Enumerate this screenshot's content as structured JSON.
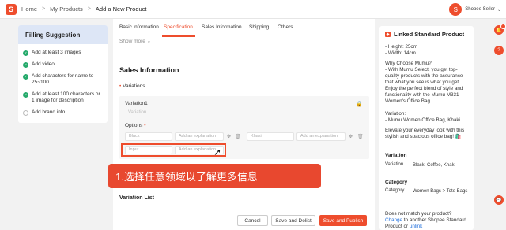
{
  "header": {
    "logo_glyph": "S",
    "breadcrumbs": [
      "Home",
      "My Products",
      "Add a New Product"
    ],
    "separator": ">",
    "user": "Shopee Seller",
    "user_caret": "⌄",
    "avatar_glyph": "S"
  },
  "filling": {
    "title": "Filling Suggestion",
    "tips": [
      {
        "text": "Add at least 3 images",
        "done": true
      },
      {
        "text": "Add video",
        "done": true
      },
      {
        "text": "Add characters for name to 25~100",
        "done": true
      },
      {
        "text": "Add at least 100 characters or 1 image for description",
        "done": true
      },
      {
        "text": "Add brand info",
        "done": false
      }
    ]
  },
  "tabs": [
    "Basic information",
    "Specification",
    "Sales Information",
    "Shipping",
    "Others"
  ],
  "active_tab": "Specification",
  "show_more": "Show more ⌄",
  "sales": {
    "title": "Sales Information",
    "variations_label": "Variations",
    "variation_label": "Variation1",
    "variation_placeholder": "Variation",
    "options_label": "Options",
    "options": [
      {
        "value": "Black",
        "explain": "Add an explanation"
      },
      {
        "value": "Khaki",
        "explain": "Add an explanation"
      },
      {
        "value": "Input",
        "explain": "Add an explanation"
      }
    ],
    "variation_list_label": "Variation List",
    "required_mark": "•"
  },
  "banner_text": "1.选择任意领域以了解更多信息",
  "footer": {
    "cancel": "Cancel",
    "save_delist": "Save and Delist",
    "save_publish": "Save and Publish"
  },
  "linked": {
    "title": "Linked Standard Product",
    "dims": [
      "- Height: 25cm",
      "- Width: 14cm"
    ],
    "why_title": "Why Choose Mumu?",
    "why_text": "- With Mumu Select, you get top-quality products with the assurance that what you see is what you get. Enjoy the perfect blend of style and functionality with the Mumu M331 Women's Office Bag.",
    "variation_note": "Variation:",
    "variation_item": "- Mumu Women Office Bag, Khaki",
    "elevate": "Elevate your everyday look with this stylish and spacious office bag! 🛍️",
    "variation_heading": "Variation",
    "variation_key": "Variation",
    "variation_val": "Black, Coffee, Khaki",
    "category_heading": "Category",
    "category_key": "Category",
    "category_val": "Women Bags > Tote Bags",
    "footer_q": "Does not match your product?",
    "footer_a_link": "Change",
    "footer_a_text": " to another Shopee Standard Product or ",
    "footer_unlink": "unlink"
  },
  "colors": {
    "accent": "#ee4d2d",
    "success": "#26aa6c",
    "link": "#2673dd",
    "tip_header": "#dde6f6"
  }
}
